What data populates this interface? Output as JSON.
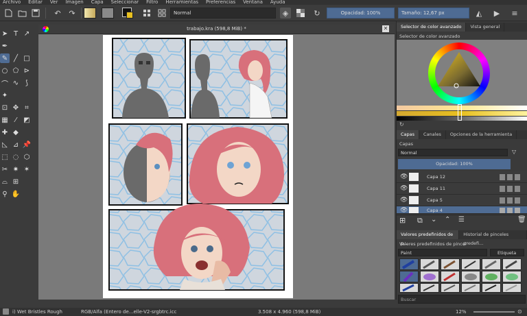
{
  "menu": [
    "Archivo",
    "Editar",
    "Ver",
    "Imagen",
    "Capa",
    "Seleccionar",
    "Filtro",
    "Herramientas",
    "Preferencias",
    "Ventana",
    "Ayuda"
  ],
  "toolbar": {
    "blend_mode": "Normal",
    "opacity": "Opacidad: 100%",
    "size": "Tamaño: 12,67 px"
  },
  "document": {
    "tab_title": "trabajo.kra (598,8 MiB) *"
  },
  "right_panel": {
    "color_tabs": [
      "Selector de color avanzado",
      "Vista general"
    ],
    "color_header": "Selector de color avanzado",
    "layer_tabs": [
      "Capas",
      "Canales",
      "Opciones de la herramienta"
    ],
    "layers_title": "Capas",
    "blend_mode": "Normal",
    "opacity": "Opacidad:  100%",
    "layers": [
      {
        "name": "Capa 12",
        "selected": false
      },
      {
        "name": "Capa 11",
        "selected": false
      },
      {
        "name": "Capa 5",
        "selected": false
      },
      {
        "name": "Capa 4",
        "selected": true
      }
    ],
    "preset_tabs": [
      "Valores predefinidos de p...",
      "Historial de pinceles predefi..."
    ],
    "preset_header": "Valores predefinidos de pincel",
    "preset_filter": "Paint",
    "tag_label": "Etiqueta",
    "search_placeholder": "Buscar"
  },
  "status": {
    "brush": "i) Wet Bristles Rough",
    "color_space": "RGB/Alfa (Entero de...elle-V2-srgbtrc.icc",
    "dimensions": "3.508 x 4.960 (598,8 MiB)",
    "zoom": "12%"
  },
  "colors": {
    "accent": "#4f6c94",
    "panel": "#3b3b3b",
    "canvas_bg": "#7a7a7a",
    "hair": "#d8707b",
    "sky": "#cfd6de",
    "cell_line": "#8ec0e4"
  }
}
